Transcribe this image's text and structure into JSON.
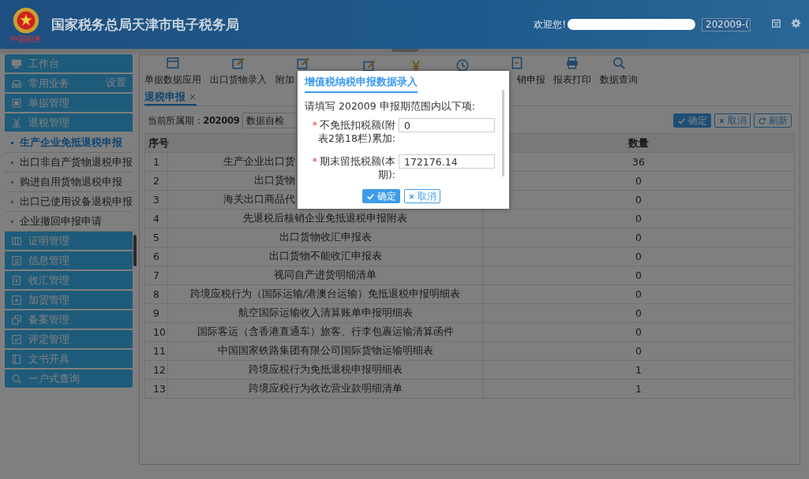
{
  "header": {
    "title": "国家税务总局天津市电子税务局",
    "logo_caption": "中国税务",
    "welcome": "欢迎您!",
    "period_field": "202009-("
  },
  "sidebar": {
    "items": [
      {
        "label": "工作台",
        "kind": "section"
      },
      {
        "label": "常用业务",
        "kind": "section",
        "action": "设置"
      },
      {
        "label": "单据管理",
        "kind": "section"
      },
      {
        "label": "退税管理",
        "kind": "section"
      },
      {
        "label": "生产企业免抵退税申报",
        "kind": "subitem",
        "selected": true
      },
      {
        "label": "出口非自产货物退税申报",
        "kind": "subitem",
        "selected": false
      },
      {
        "label": "购进自用货物退税申报",
        "kind": "subitem",
        "selected": false
      },
      {
        "label": "出口已使用设备退税申报",
        "kind": "subitem",
        "selected": false
      },
      {
        "label": "企业撤回申报申请",
        "kind": "subitem",
        "selected": false
      },
      {
        "label": "证明管理",
        "kind": "section"
      },
      {
        "label": "信息管理",
        "kind": "section"
      },
      {
        "label": "收汇管理",
        "kind": "section"
      },
      {
        "label": "加贸管理",
        "kind": "section"
      },
      {
        "label": "备案管理",
        "kind": "section"
      },
      {
        "label": "评定管理",
        "kind": "section"
      },
      {
        "label": "文书开具",
        "kind": "section"
      },
      {
        "label": "一户式查询",
        "kind": "section"
      }
    ]
  },
  "toolbar": {
    "items": [
      {
        "kind": "labeled",
        "label": "单据数据应用"
      },
      {
        "kind": "labeled",
        "label": "出口货物录入"
      },
      {
        "kind": "cut_right",
        "label": "附加"
      },
      {
        "kind": "icon"
      },
      {
        "kind": "icon"
      },
      {
        "kind": "icon"
      },
      {
        "kind": "cut_left",
        "label": "销申报"
      },
      {
        "kind": "labeled",
        "label": "报表打印"
      },
      {
        "kind": "labeled",
        "label": "数据查询"
      }
    ]
  },
  "tabs": [
    {
      "label": "退税申报",
      "selected": true,
      "close": "×"
    }
  ],
  "filter": {
    "period": "当前所属期：**202009**",
    "check_dropdown": "数据自检"
  },
  "actions": [
    {
      "kind": "primary",
      "label": "确定"
    },
    {
      "kind": "cancel",
      "label": "取消"
    },
    {
      "kind": "refresh",
      "label": "刷新"
    }
  ],
  "table": {
    "columns": [
      "序号",
      "数量"
    ],
    "rows": [
      {
        "no": "1",
        "name": "生产企业出口货",
        "clipped": true,
        "count": "36"
      },
      {
        "no": "2",
        "name": "出口货物",
        "clipped": true,
        "count": "0"
      },
      {
        "no": "3",
        "name": "海关出口商品代",
        "clipped": true,
        "count": "0"
      },
      {
        "no": "4",
        "name": "先退税后核销企业免抵退税申报附表",
        "clipped": false,
        "count": "0"
      },
      {
        "no": "5",
        "name": "出口货物收汇申报表",
        "clipped": false,
        "count": "0"
      },
      {
        "no": "6",
        "name": "出口货物不能收汇申报表",
        "clipped": false,
        "count": "0"
      },
      {
        "no": "7",
        "name": "视同自产进货明细清单",
        "clipped": false,
        "count": "0"
      },
      {
        "no": "8",
        "name": "跨境应税行为（国际运输/港澳台运输）免抵退税申报明细表",
        "clipped": false,
        "count": "0"
      },
      {
        "no": "9",
        "name": "航空国际运输收入清算账单申报明细表",
        "clipped": false,
        "count": "0"
      },
      {
        "no": "10",
        "name": "国际客运（含香港直通车）旅客、行李包裹运输清算函件",
        "clipped": false,
        "count": "0"
      },
      {
        "no": "11",
        "name": "中国国家铁路集团有限公司国际货物运输明细表",
        "clipped": false,
        "count": "0"
      },
      {
        "no": "12",
        "name": "跨境应税行为免抵退税申报明细表",
        "clipped": false,
        "count": "1"
      },
      {
        "no": "13",
        "name": "跨境应税行为收讫营业款明细清单",
        "clipped": false,
        "count": "1"
      }
    ]
  },
  "dialog": {
    "title": "增值税纳税申报数据录入",
    "intro": "请填写 202009 申报期范围内以下项:",
    "fields": [
      {
        "required": true,
        "required_mark": "*",
        "label": "不免抵扣税额(附表2第18栏)累加:",
        "value": "0"
      },
      {
        "required": true,
        "required_mark": "*",
        "label": "期末留抵税额(本期):",
        "value": "172176.14"
      }
    ],
    "buttons": [
      {
        "kind": "primary",
        "label": "确定"
      },
      {
        "kind": "cancel",
        "label": "取消"
      }
    ]
  }
}
